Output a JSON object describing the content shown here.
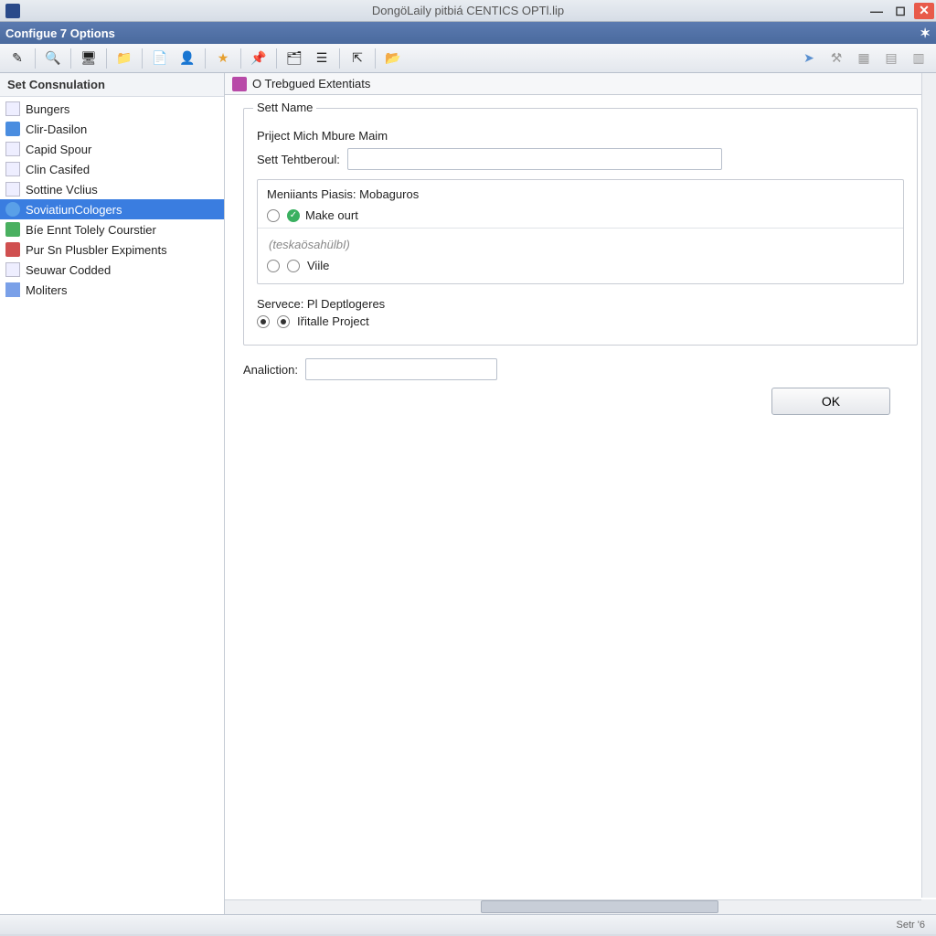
{
  "window": {
    "title": "DongöLaily pitbiá CENTICS OPTl.lip"
  },
  "subheader": {
    "title": "Configue 7 Options"
  },
  "toolbar": {
    "icons": [
      "edit-icon",
      "search-icon",
      "monitor-icon",
      "folder-icon",
      "doc-icon",
      "user-red-icon",
      "star-icon",
      "pin-icon",
      "app-icon",
      "list-icon",
      "export-icon",
      "open-icon"
    ]
  },
  "sidebar": {
    "header": "Set Consnulation",
    "items": [
      {
        "label": "Bungers",
        "icon": "page"
      },
      {
        "label": "Clir-Dasilon",
        "icon": "blue"
      },
      {
        "label": "Capid Spour",
        "icon": "page"
      },
      {
        "label": "Clin Casifed",
        "icon": "page"
      },
      {
        "label": "Sottine Vclius",
        "icon": "page"
      },
      {
        "label": "SoviatiunCologers",
        "icon": "db"
      },
      {
        "label": "Bíe Ennt Tolely Courstier",
        "icon": "green"
      },
      {
        "label": "Pur Sn Plusbler Expiments",
        "icon": "red"
      },
      {
        "label": "Seuwar Codded",
        "icon": "page"
      },
      {
        "label": "Moliters",
        "icon": "wiz"
      }
    ],
    "selected_index": 5
  },
  "main": {
    "tab_title": "O Trebgued Extentiats",
    "group1_legend": "Sett Name",
    "project_label": "Priject Mich Mbure Maim",
    "field1_label": "Sett Tehtberoul:",
    "field1_value": "",
    "subgroup_legend": "Meniiants Piasis: Mobaguros",
    "opt1_label": "Make ourt",
    "hint_text": "(teskaösahülbI)",
    "opt2_label": "Viile",
    "service_label": "Servece: Pl Deptlogeres",
    "service_opt": "Iřitalle Project",
    "analiction_label": "Analiction:",
    "analiction_value": "",
    "ok_label": "OK"
  },
  "status": {
    "right": "Setr '6"
  }
}
